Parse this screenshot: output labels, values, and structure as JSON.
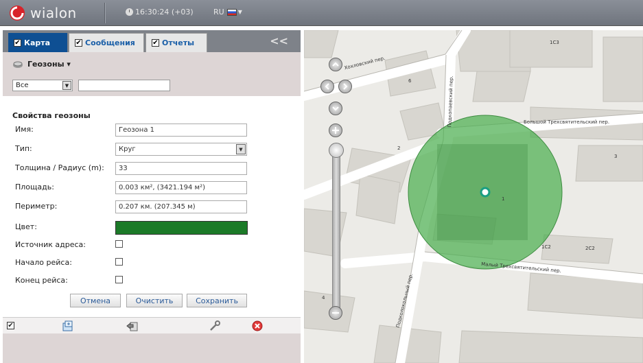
{
  "header": {
    "logo_text": "wialon",
    "time": "16:30:24 (+03)",
    "language": "RU"
  },
  "tabs": [
    {
      "label": "Карта",
      "checked": true,
      "active": true
    },
    {
      "label": "Сообщения",
      "checked": true,
      "active": false
    },
    {
      "label": "Отчеты",
      "checked": true,
      "active": false
    }
  ],
  "collapse_label": "<<",
  "geozones": {
    "section_title": "Геозоны",
    "filter_select_value": "Все",
    "filter_input_value": ""
  },
  "properties": {
    "title": "Свойства геозоны",
    "name_label": "Имя:",
    "name_value": "Геозона 1",
    "type_label": "Тип:",
    "type_value": "Круг",
    "radius_label": "Толщина / Радиус (m):",
    "radius_value": "33",
    "area_label": "Площадь:",
    "area_value": "0.003 км², (3421.194 м²)",
    "perimeter_label": "Периметр:",
    "perimeter_value": "0.207 км. (207.345 м)",
    "color_label": "Цвет:",
    "color_value": "#1c7a28",
    "address_source_label": "Источник адреса:",
    "trip_start_label": "Начало рейса:",
    "trip_end_label": "Конец рейса:",
    "address_source_checked": false,
    "trip_start_checked": false,
    "trip_end_checked": false
  },
  "buttons": {
    "cancel": "Отмена",
    "clear": "Очистить",
    "save": "Сохранить"
  },
  "map": {
    "street_labels": [
      "Большой Трехсвятительский пер.",
      "Малый Трехсвятительский пер.",
      "Хохловский пер.",
      "Подкопаевский пер.",
      "Подколокольный пер."
    ],
    "building_numbers": [
      "1С3",
      "1С2",
      "2С2",
      "6",
      "2",
      "3",
      "4",
      "1"
    ],
    "geozone_color": "#4caf50"
  }
}
